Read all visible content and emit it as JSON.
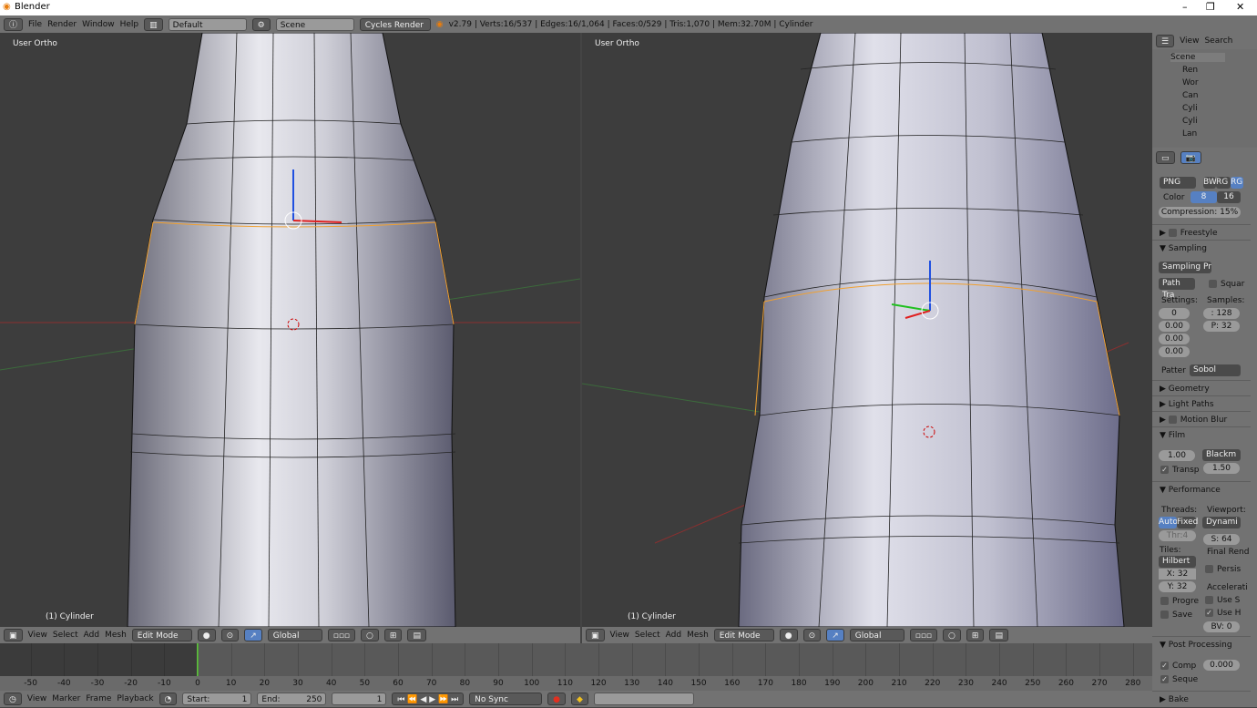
{
  "window": {
    "title": "Blender",
    "controls": [
      "–",
      "❐",
      "✕"
    ]
  },
  "info_header": {
    "menus": [
      "File",
      "Render",
      "Window",
      "Help"
    ],
    "layout": "Default",
    "scene": "Scene",
    "engine": "Cycles Render",
    "stats": "v2.79 | Verts:16/537 | Edges:16/1,064 | Faces:0/529 | Tris:1,070 | Mem:32.70M | Cylinder"
  },
  "viewports": [
    {
      "label": "User Ortho",
      "object": "(1) Cylinder"
    },
    {
      "label": "User Ortho",
      "object": "(1) Cylinder"
    }
  ],
  "view3d_header": {
    "menus": [
      "View",
      "Select",
      "Add",
      "Mesh"
    ],
    "mode": "Edit Mode",
    "orientation": "Global"
  },
  "timeline": {
    "ticks": [
      "-50",
      "-40",
      "-30",
      "-20",
      "-10",
      "0",
      "10",
      "20",
      "30",
      "40",
      "50",
      "60",
      "70",
      "80",
      "90",
      "100",
      "110",
      "120",
      "130",
      "140",
      "150",
      "160",
      "170",
      "180",
      "190",
      "200",
      "210",
      "220",
      "230",
      "240",
      "250",
      "260",
      "270",
      "280"
    ],
    "current_frame": 0,
    "menus": [
      "View",
      "Marker",
      "Frame",
      "Playback"
    ],
    "start_label": "Start:",
    "start": "1",
    "end_label": "End:",
    "end": "250",
    "frame": "1",
    "sync": "No Sync"
  },
  "outliner": {
    "menus": [
      "View",
      "Search"
    ],
    "items": [
      "Scene",
      "Ren",
      "Wor",
      "Can",
      "Cyli",
      "Cyli",
      "Lan"
    ]
  },
  "properties": {
    "format": "PNG",
    "color_modes": [
      "BW",
      "RG",
      "RG"
    ],
    "color_label": "Color",
    "depths": [
      "8",
      "16"
    ],
    "compression": "Compression: 15%",
    "panels": {
      "freestyle": "Freestyle",
      "sampling": "Sampling",
      "geometry": "Geometry",
      "light_paths": "Light Paths",
      "motion_blur": "Motion Blur",
      "film": "Film",
      "performance": "Performance",
      "post_processing": "Post Processing",
      "bake": "Bake"
    },
    "sampling": {
      "preset": "Sampling Pr",
      "integrator": "Path Tra",
      "square": "Squar",
      "settings_label": "Settings:",
      "samples_label": "Samples:",
      "seed": "0",
      "v1": "0.00",
      "v2": "0.00",
      "v3": "0.00",
      "render": ": 128",
      "preview": "P: 32",
      "pattern_label": "Patter",
      "pattern": "Sobol"
    },
    "film": {
      "exposure": "1.00",
      "filter": "Blackm",
      "transparent": "Transp",
      "width": "1.50"
    },
    "performance": {
      "threads_label": "Threads:",
      "auto": "Auto-",
      "fixed": "Fixed",
      "threads": "Thr:4",
      "viewport_label": "Viewport:",
      "viewport": "Dynami",
      "size": "S: 64",
      "tiles_label": "Tiles:",
      "tiles": "Hilbert",
      "x": "X: 32",
      "y": "Y: 32",
      "final_label": "Final Rend",
      "persis": "Persis",
      "accel_label": "Accelerati",
      "progre": "Progre",
      "save": "Save",
      "use_s": "Use S",
      "use_h": "Use H",
      "bv": "BV: 0"
    },
    "post": {
      "comp": "Comp",
      "comp_val": "0.000",
      "seque": "Seque"
    }
  },
  "colors": {
    "accent": "#5680c2",
    "frame_line": "#60c040",
    "selection": "#f0a030"
  }
}
